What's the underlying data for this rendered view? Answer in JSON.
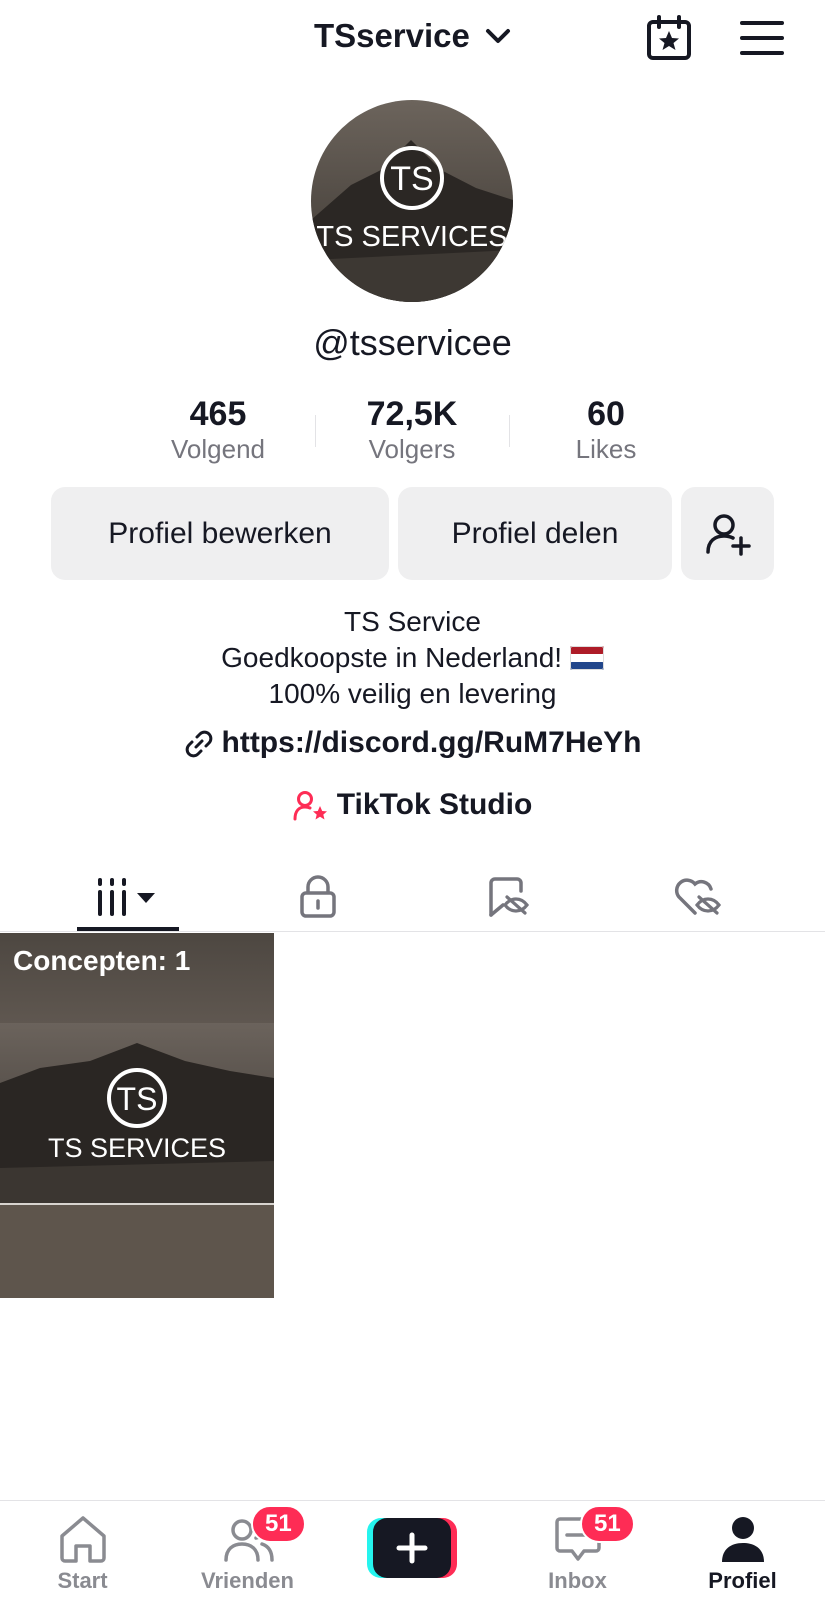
{
  "header": {
    "title": "TSservice",
    "calendar_icon": "calendar-star-icon",
    "menu_icon": "hamburger-menu-icon"
  },
  "profile": {
    "avatar_text": "TS SERVICES",
    "avatar_monogram": "TS",
    "handle": "@tsservicee"
  },
  "stats": [
    {
      "value": "465",
      "label": "Volgend"
    },
    {
      "value": "72,5K",
      "label": "Volgers"
    },
    {
      "value": "60",
      "label": "Likes"
    }
  ],
  "buttons": {
    "edit": "Profiel bewerken",
    "share": "Profiel delen",
    "add_friend_icon": "add-user-icon"
  },
  "bio": {
    "line1": "TS Service",
    "line2": "Goedkoopste in Nederland!",
    "line3": "100% veilig en levering",
    "link": "https://discord.gg/RuM7HeYh",
    "studio": "TikTok Studio"
  },
  "tabs": [
    "videos-grid-icon",
    "lock-icon",
    "repost-hidden-icon",
    "liked-hidden-icon"
  ],
  "drafts": {
    "label": "Concepten: 1",
    "thumb_text": "TS SERVICES",
    "thumb_monogram": "TS"
  },
  "nav": {
    "start": "Start",
    "friends": "Vrienden",
    "friends_badge": "51",
    "inbox": "Inbox",
    "inbox_badge": "51",
    "profile": "Profiel"
  },
  "colors": {
    "accent": "#fe2c55",
    "cyan": "#25f4ee",
    "text": "#161823",
    "muted": "#75757d"
  }
}
